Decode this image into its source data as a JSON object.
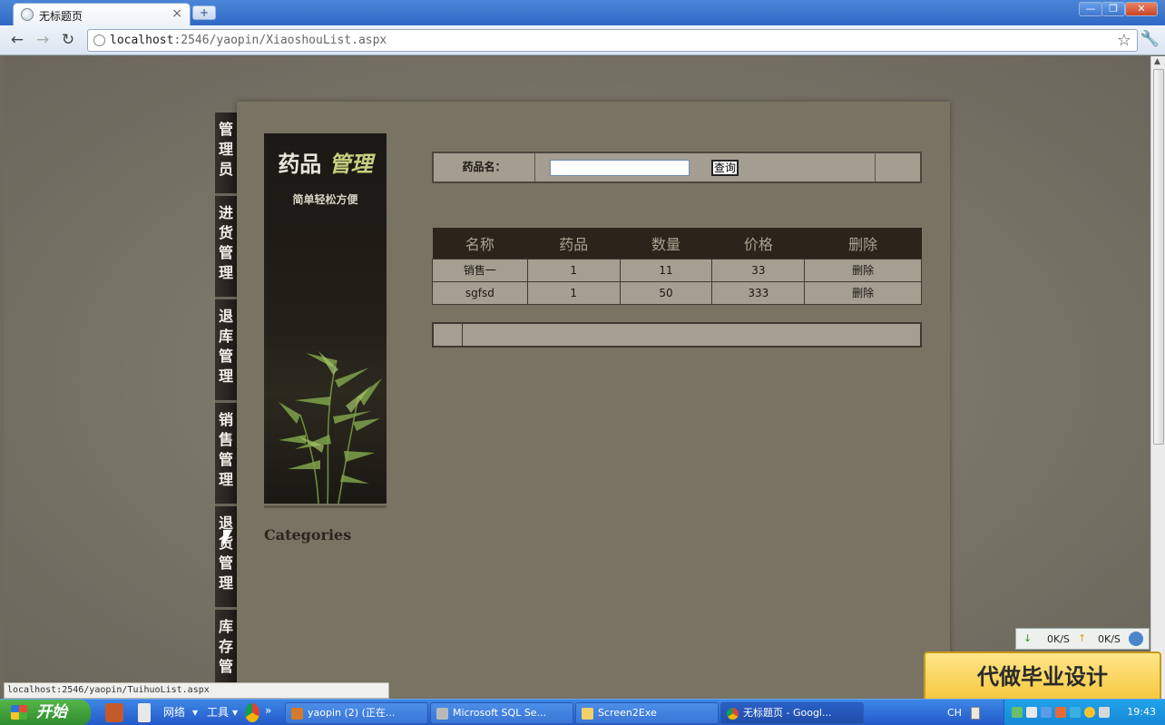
{
  "browser": {
    "tab_title": "无标题页",
    "tab_close": "×",
    "new_tab": "+",
    "url_host": "localhost",
    "url_rest": ":2546/yaopin/XiaoshouList.aspx",
    "window_minimize": "—",
    "window_restore": "❐",
    "window_close": "✕"
  },
  "nav": {
    "items": [
      {
        "label": "管理员"
      },
      {
        "label": "进货管理"
      },
      {
        "label": "退库管理"
      },
      {
        "label": "销售管理"
      },
      {
        "label": "退货管理"
      },
      {
        "label": "库存管"
      }
    ]
  },
  "banner": {
    "title_part1": "药品",
    "title_part2": "管理",
    "subtitle": "简单轻松方便",
    "categories": "Categories"
  },
  "search": {
    "label": "药品名：",
    "input_value": "",
    "button_label": "查询"
  },
  "table": {
    "headers": [
      "名称",
      "药品",
      "数量",
      "价格",
      "删除"
    ],
    "rows": [
      {
        "name": "销售一",
        "drug": "1",
        "qty": "11",
        "price": "33",
        "action": "删除"
      },
      {
        "name": "sgfsd",
        "drug": "1",
        "qty": "50",
        "price": "333",
        "action": "删除"
      }
    ]
  },
  "status": {
    "link_preview": "localhost:2546/yaopin/TuihuoList.aspx"
  },
  "speed": {
    "down": "0K/S",
    "up": "0K/S"
  },
  "promo": {
    "text": "代做毕业设计"
  },
  "taskbar": {
    "start": "开始",
    "quick1": "网络",
    "quick2": "工具",
    "tasks": [
      {
        "label": "yaopin (2) (正在..."
      },
      {
        "label": "Microsoft SQL Se..."
      },
      {
        "label": "Screen2Exe"
      },
      {
        "label": "无标题页 - Googl..."
      }
    ],
    "lang": "CH",
    "clock": "19:43"
  },
  "colors": {
    "page_bg": "#6e6a5e",
    "panel": "#787363",
    "table_header": "#2a241b",
    "table_cell": "#a49f91",
    "nav_item": "#2a2620"
  }
}
